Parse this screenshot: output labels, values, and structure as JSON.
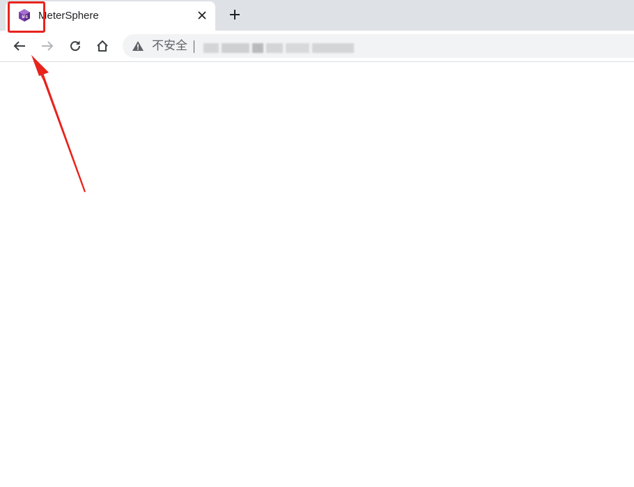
{
  "browser": {
    "tab": {
      "title": "MeterSphere",
      "favicon_icon": "metersphere-logo-icon",
      "close_icon": "close-icon"
    },
    "new_tab_icon": "plus-icon",
    "toolbar": {
      "back_icon": "arrow-left-icon",
      "forward_icon": "arrow-right-icon",
      "reload_icon": "reload-icon",
      "home_icon": "home-icon"
    },
    "omnibox": {
      "security_icon": "warning-icon",
      "security_label": "不安全",
      "url": ""
    }
  },
  "annotation": {
    "highlight_color": "#e8231c"
  }
}
